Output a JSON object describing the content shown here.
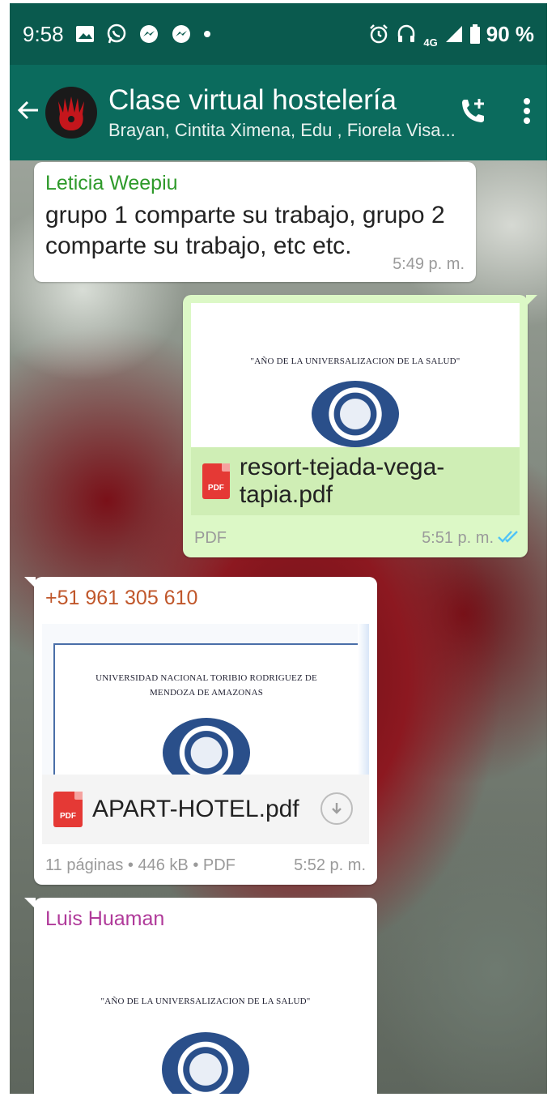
{
  "status_bar": {
    "time": "9:58",
    "battery": "90 %",
    "network": "4G",
    "icons": [
      "image-icon",
      "whatsapp-icon",
      "messenger-icon",
      "messenger-icon",
      "dot-icon",
      "alarm-icon",
      "headset-icon",
      "signal-icon",
      "battery-icon"
    ]
  },
  "header": {
    "back_icon": "arrow-left-icon",
    "title": "Clase virtual hostelería",
    "subtitle": "Brayan, Cintita Ximena, Edu , Fiorela Visa...",
    "actions": [
      "add-call-icon",
      "more-vert-icon"
    ]
  },
  "messages": [
    {
      "sender": "Leticia Weepiu",
      "sender_color": "#2e9a2a",
      "text": "grupo 1 comparte su trabajo, grupo 2 comparte su trabajo, etc etc.",
      "time": "5:49 p. m."
    },
    {
      "doc_heading": "\"AÑO DE LA UNIVERSALIZACION DE LA SALUD\"",
      "file_icon": "PDF",
      "file_name": "resort-tejada-vega-tapia.pdf",
      "file_type": "PDF",
      "time": "5:51 p. m.",
      "status": "read"
    },
    {
      "sender": "+51 961 305 610",
      "sender_color": "#c0572b",
      "doc_heading": "UNIVERSIDAD NACIONAL TORIBIO RODRIGUEZ DE MENDOZA DE AMAZONAS",
      "file_icon": "PDF",
      "file_name": "APART-HOTEL.pdf",
      "meta": "11 páginas • 446 kB • PDF",
      "time": "5:52 p. m."
    },
    {
      "sender": "Luis Huaman",
      "sender_color": "#b03a9a",
      "doc_heading": "\"AÑO DE LA UNIVERSALIZACION DE LA SALUD\""
    }
  ],
  "colors": {
    "status_bar": "#0a5a4e",
    "app_bar": "#0b6b5d",
    "outgoing_bubble": "#dcf8c6",
    "read_ticks": "#4fc3f7"
  }
}
